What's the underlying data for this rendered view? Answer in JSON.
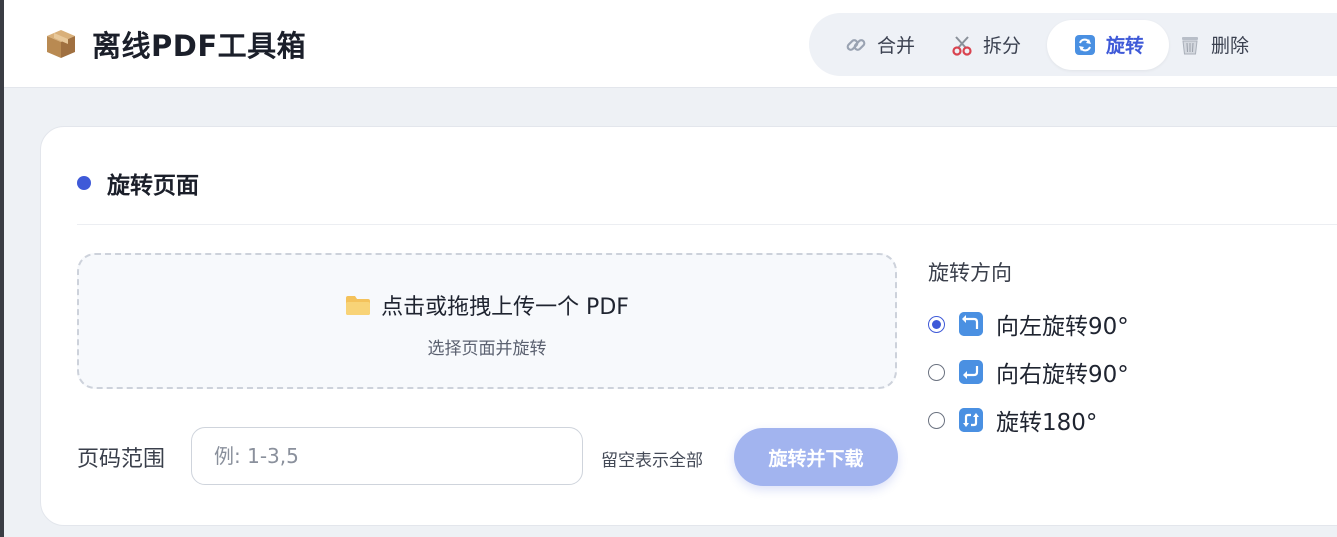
{
  "app": {
    "title": "离线PDF工具箱",
    "brand_icon": "package-icon"
  },
  "nav": {
    "tabs": [
      {
        "label": "合并",
        "icon": "link-icon",
        "active": false
      },
      {
        "label": "拆分",
        "icon": "scissors-icon",
        "active": false
      },
      {
        "label": "旋转",
        "icon": "rotate-icon",
        "active": true
      },
      {
        "label": "删除",
        "icon": "trash-icon",
        "active": false
      }
    ]
  },
  "card": {
    "title": "旋转页面",
    "dropzone": {
      "main": "点击或拖拽上传一个 PDF",
      "sub": "选择页面并旋转",
      "icon": "folder-icon"
    },
    "range": {
      "label": "页码范围",
      "placeholder": "例: 1-3,5",
      "value": "",
      "hint": "留空表示全部"
    },
    "submit_label": "旋转并下载",
    "direction": {
      "title": "旋转方向",
      "options": [
        {
          "label": "向左旋转90°",
          "icon": "rotate-left-icon",
          "checked": true
        },
        {
          "label": "向右旋转90°",
          "icon": "rotate-right-icon",
          "checked": false
        },
        {
          "label": "旋转180°",
          "icon": "rotate-180-icon",
          "checked": false
        }
      ]
    }
  },
  "colors": {
    "accent": "#3f5ad8",
    "button_disabled": "#a2b4ef",
    "background": "#eef1f5"
  }
}
